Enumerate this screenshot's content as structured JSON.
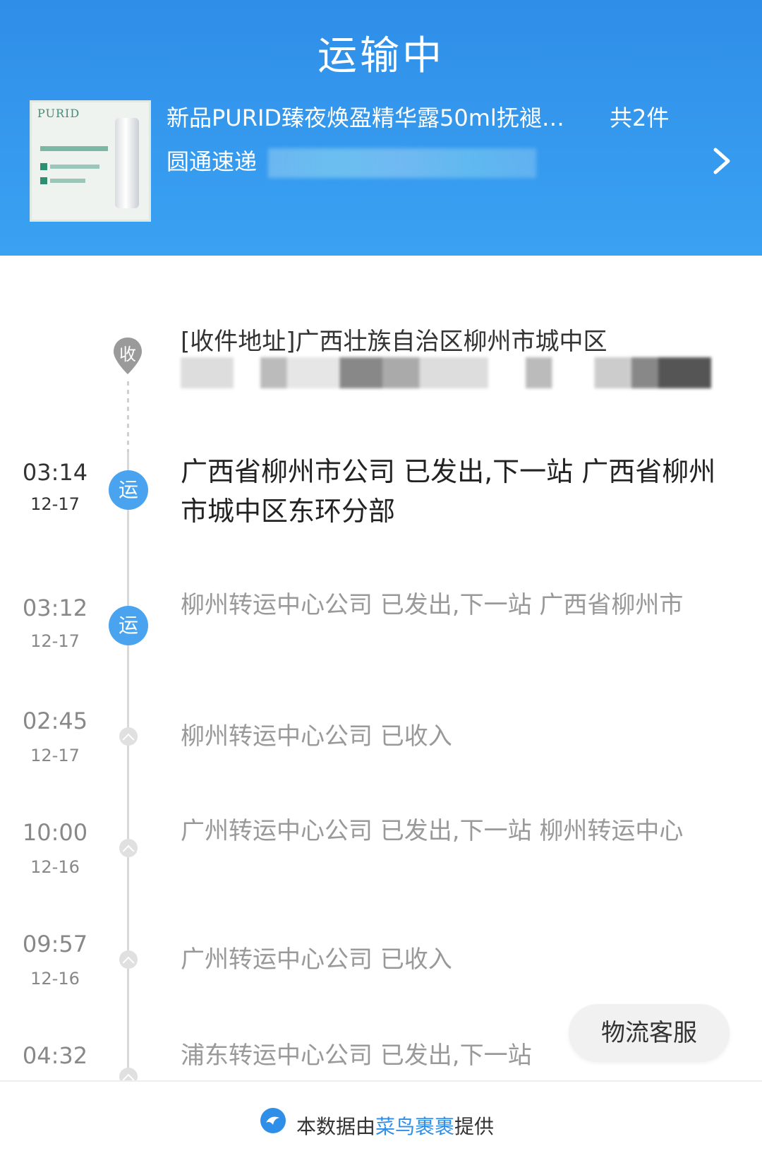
{
  "header": {
    "status": "运输中",
    "product_name": "新品PURID臻夜焕盈精华露50ml抚褪…",
    "product_count": "共2件",
    "carrier": "圆通速递",
    "thumbnail_brand": "PURID"
  },
  "address": {
    "pin_label": "收",
    "text": "[收件地址]广西壮族自治区柳州市城中区"
  },
  "events": [
    {
      "time": "03:14",
      "date": "12-17",
      "node": "运",
      "desc": "广西省柳州市公司 已发出,下一站 广西省柳州市城中区东环分部"
    },
    {
      "time": "03:12",
      "date": "12-17",
      "node": "运",
      "desc": "柳州转运中心公司 已发出,下一站 广西省柳州市"
    },
    {
      "time": "02:45",
      "date": "12-17",
      "desc": "柳州转运中心公司 已收入"
    },
    {
      "time": "10:00",
      "date": "12-16",
      "desc": "广州转运中心公司 已发出,下一站 柳州转运中心"
    },
    {
      "time": "09:57",
      "date": "12-16",
      "desc": "广州转运中心公司 已收入"
    },
    {
      "time": "04:32",
      "date": "",
      "desc": "浦东转运中心公司 已发出,下一站"
    }
  ],
  "cs_button": "物流客服",
  "footer": {
    "prefix": "本数据由",
    "brand": "菜鸟裹裹",
    "suffix": "提供"
  },
  "colors": {
    "header_blue": "#2f8ee8",
    "node_blue": "#4aa3ee"
  }
}
